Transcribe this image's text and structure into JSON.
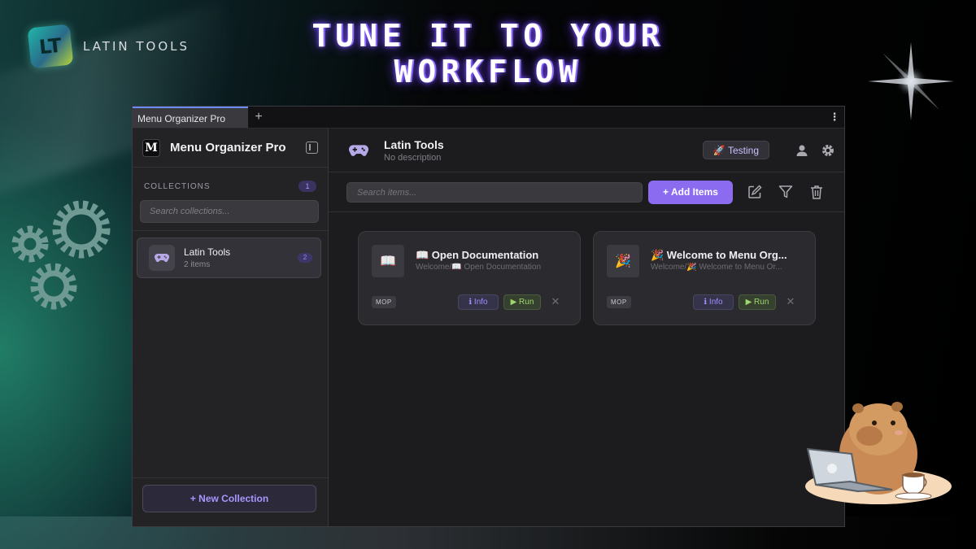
{
  "brand": {
    "name": "LATIN TOOLS",
    "mark": "LT"
  },
  "headline": {
    "line1": "TUNE IT TO YOUR",
    "line2": "WORKFLOW"
  },
  "window": {
    "tab_label": "Menu Organizer Pro",
    "tab_add": "+",
    "tab_menu": "⋮"
  },
  "sidebar": {
    "app_logo": "M",
    "app_title": "Menu Organizer Pro",
    "collections_label": "COLLECTIONS",
    "collections_count": "1",
    "search_placeholder": "Search collections...",
    "items": [
      {
        "name": "Latin Tools",
        "sub": "2 items",
        "count": "2",
        "icon": "gamepad-icon"
      }
    ],
    "new_collection_label": "+ New Collection"
  },
  "main": {
    "header": {
      "title": "Latin Tools",
      "description": "No description",
      "badge": "🚀 Testing",
      "icon": "gamepad-icon"
    },
    "toolbar": {
      "search_placeholder": "Search items...",
      "add_label": "+ Add Items"
    },
    "cards": [
      {
        "thumb": "📖",
        "title": "📖 Open Documentation",
        "path": "Welcome/📖 Open Documentation",
        "tag": "MOP",
        "info_label": "ℹ Info",
        "run_label": "▶ Run",
        "close": "✕"
      },
      {
        "thumb": "🎉",
        "title": "🎉 Welcome to Menu Org...",
        "path": "Welcome/🎉 Welcome to Menu Or...",
        "tag": "MOP",
        "info_label": "ℹ Info",
        "run_label": "▶ Run",
        "close": "✕"
      }
    ]
  },
  "colors": {
    "accent": "#8b6cf0",
    "run_green": "#9ed66d",
    "window_bg": "#1c1c1f",
    "sidebar_bg": "#232326"
  }
}
